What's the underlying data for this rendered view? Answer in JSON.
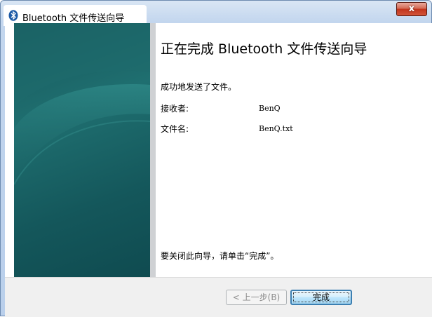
{
  "window": {
    "title": "Bluetooth 文件传送向导",
    "close_label": "x"
  },
  "main": {
    "heading": "正在完成 Bluetooth 文件传送向导",
    "success_text": "成功地发送了文件。",
    "receiver_label": "接收者:",
    "receiver_value": "BenQ",
    "filename_label": "文件名:",
    "filename_value": "BenQ.txt",
    "closing_hint": "要关闭此向导，请单击“完成”。"
  },
  "buttons": {
    "back_label": "< 上一步(B)",
    "finish_label": "完成"
  },
  "colors": {
    "side_panel": "#1a6163",
    "close_button": "#c2341c",
    "finish_border": "#3c7fb1"
  },
  "icons": {
    "title_icon": "bluetooth-icon",
    "close_icon": "close-icon"
  }
}
